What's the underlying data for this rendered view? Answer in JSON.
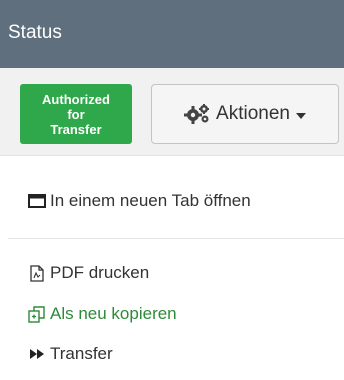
{
  "header": {
    "title": "Status"
  },
  "badge": {
    "line1": "Authorized",
    "line2": "for",
    "line3": "Transfer",
    "color": "#2ea84a"
  },
  "actions": {
    "label": "Aktionen",
    "icon": "gears-icon"
  },
  "menu": {
    "open_new_tab": {
      "label": "In einem neuen Tab öffnen",
      "icon": "window-icon"
    },
    "print_pdf": {
      "label": "PDF drucken",
      "icon": "pdf-file-icon"
    },
    "copy_new": {
      "label": "Als neu kopieren",
      "icon": "copy-icon",
      "color": "#2e8a3a"
    },
    "transfer": {
      "label": "Transfer",
      "icon": "fast-forward-icon"
    }
  },
  "colors": {
    "header_bg": "#5f6f7d",
    "subbar_bg": "#f1f1f1"
  }
}
